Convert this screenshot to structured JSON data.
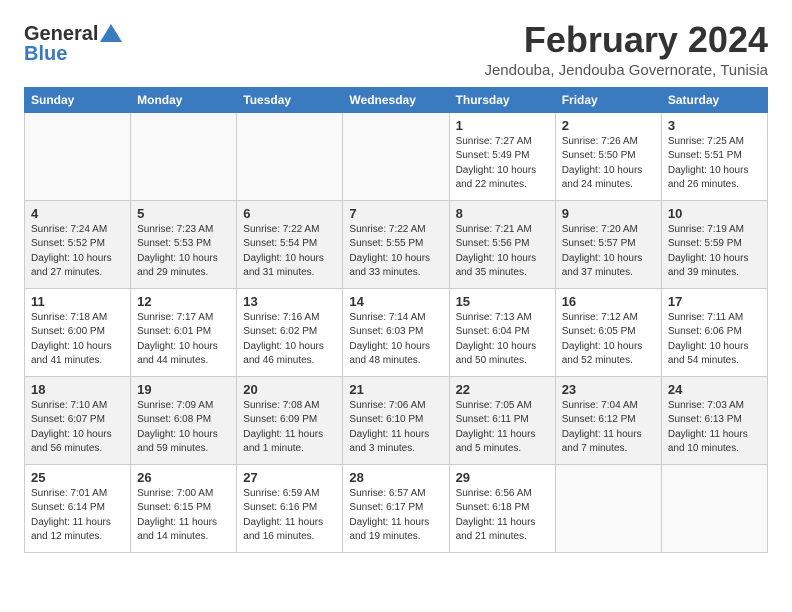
{
  "header": {
    "logo_general": "General",
    "logo_blue": "Blue",
    "month_title": "February 2024",
    "location": "Jendouba, Jendouba Governorate, Tunisia"
  },
  "days_of_week": [
    "Sunday",
    "Monday",
    "Tuesday",
    "Wednesday",
    "Thursday",
    "Friday",
    "Saturday"
  ],
  "weeks": [
    [
      {
        "day": "",
        "info": ""
      },
      {
        "day": "",
        "info": ""
      },
      {
        "day": "",
        "info": ""
      },
      {
        "day": "",
        "info": ""
      },
      {
        "day": "1",
        "info": "Sunrise: 7:27 AM\nSunset: 5:49 PM\nDaylight: 10 hours and 22 minutes."
      },
      {
        "day": "2",
        "info": "Sunrise: 7:26 AM\nSunset: 5:50 PM\nDaylight: 10 hours and 24 minutes."
      },
      {
        "day": "3",
        "info": "Sunrise: 7:25 AM\nSunset: 5:51 PM\nDaylight: 10 hours and 26 minutes."
      }
    ],
    [
      {
        "day": "4",
        "info": "Sunrise: 7:24 AM\nSunset: 5:52 PM\nDaylight: 10 hours and 27 minutes."
      },
      {
        "day": "5",
        "info": "Sunrise: 7:23 AM\nSunset: 5:53 PM\nDaylight: 10 hours and 29 minutes."
      },
      {
        "day": "6",
        "info": "Sunrise: 7:22 AM\nSunset: 5:54 PM\nDaylight: 10 hours and 31 minutes."
      },
      {
        "day": "7",
        "info": "Sunrise: 7:22 AM\nSunset: 5:55 PM\nDaylight: 10 hours and 33 minutes."
      },
      {
        "day": "8",
        "info": "Sunrise: 7:21 AM\nSunset: 5:56 PM\nDaylight: 10 hours and 35 minutes."
      },
      {
        "day": "9",
        "info": "Sunrise: 7:20 AM\nSunset: 5:57 PM\nDaylight: 10 hours and 37 minutes."
      },
      {
        "day": "10",
        "info": "Sunrise: 7:19 AM\nSunset: 5:59 PM\nDaylight: 10 hours and 39 minutes."
      }
    ],
    [
      {
        "day": "11",
        "info": "Sunrise: 7:18 AM\nSunset: 6:00 PM\nDaylight: 10 hours and 41 minutes."
      },
      {
        "day": "12",
        "info": "Sunrise: 7:17 AM\nSunset: 6:01 PM\nDaylight: 10 hours and 44 minutes."
      },
      {
        "day": "13",
        "info": "Sunrise: 7:16 AM\nSunset: 6:02 PM\nDaylight: 10 hours and 46 minutes."
      },
      {
        "day": "14",
        "info": "Sunrise: 7:14 AM\nSunset: 6:03 PM\nDaylight: 10 hours and 48 minutes."
      },
      {
        "day": "15",
        "info": "Sunrise: 7:13 AM\nSunset: 6:04 PM\nDaylight: 10 hours and 50 minutes."
      },
      {
        "day": "16",
        "info": "Sunrise: 7:12 AM\nSunset: 6:05 PM\nDaylight: 10 hours and 52 minutes."
      },
      {
        "day": "17",
        "info": "Sunrise: 7:11 AM\nSunset: 6:06 PM\nDaylight: 10 hours and 54 minutes."
      }
    ],
    [
      {
        "day": "18",
        "info": "Sunrise: 7:10 AM\nSunset: 6:07 PM\nDaylight: 10 hours and 56 minutes."
      },
      {
        "day": "19",
        "info": "Sunrise: 7:09 AM\nSunset: 6:08 PM\nDaylight: 10 hours and 59 minutes."
      },
      {
        "day": "20",
        "info": "Sunrise: 7:08 AM\nSunset: 6:09 PM\nDaylight: 11 hours and 1 minute."
      },
      {
        "day": "21",
        "info": "Sunrise: 7:06 AM\nSunset: 6:10 PM\nDaylight: 11 hours and 3 minutes."
      },
      {
        "day": "22",
        "info": "Sunrise: 7:05 AM\nSunset: 6:11 PM\nDaylight: 11 hours and 5 minutes."
      },
      {
        "day": "23",
        "info": "Sunrise: 7:04 AM\nSunset: 6:12 PM\nDaylight: 11 hours and 7 minutes."
      },
      {
        "day": "24",
        "info": "Sunrise: 7:03 AM\nSunset: 6:13 PM\nDaylight: 11 hours and 10 minutes."
      }
    ],
    [
      {
        "day": "25",
        "info": "Sunrise: 7:01 AM\nSunset: 6:14 PM\nDaylight: 11 hours and 12 minutes."
      },
      {
        "day": "26",
        "info": "Sunrise: 7:00 AM\nSunset: 6:15 PM\nDaylight: 11 hours and 14 minutes."
      },
      {
        "day": "27",
        "info": "Sunrise: 6:59 AM\nSunset: 6:16 PM\nDaylight: 11 hours and 16 minutes."
      },
      {
        "day": "28",
        "info": "Sunrise: 6:57 AM\nSunset: 6:17 PM\nDaylight: 11 hours and 19 minutes."
      },
      {
        "day": "29",
        "info": "Sunrise: 6:56 AM\nSunset: 6:18 PM\nDaylight: 11 hours and 21 minutes."
      },
      {
        "day": "",
        "info": ""
      },
      {
        "day": "",
        "info": ""
      }
    ]
  ]
}
